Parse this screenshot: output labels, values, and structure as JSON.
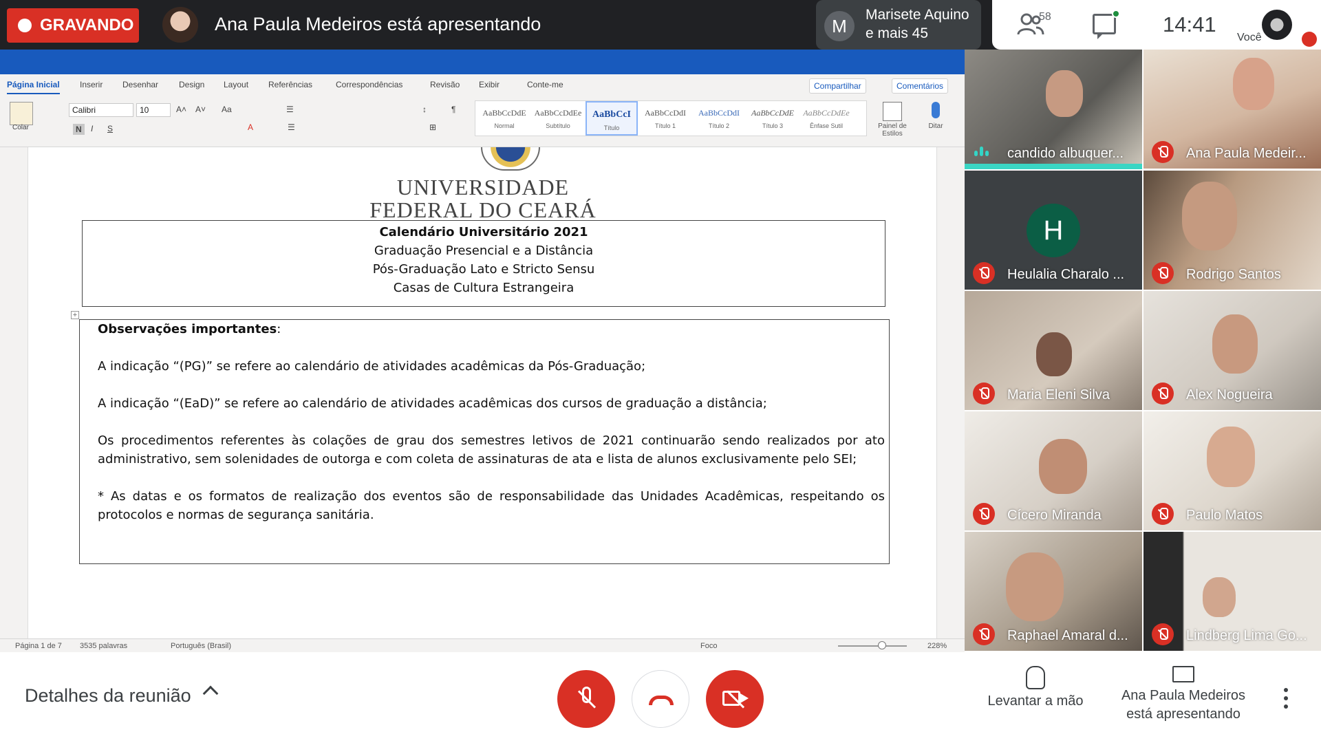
{
  "topbar": {
    "recording_label": "GRAVANDO",
    "presenter_text": "Ana Paula Medeiros está apresentando",
    "others_initial": "M",
    "others_line1": "Marisete Aquino",
    "others_line2": "e mais 45",
    "people_count": "58",
    "clock": "14:41",
    "you_label": "Você"
  },
  "word": {
    "tabs": [
      "Página Inicial",
      "Inserir",
      "Desenhar",
      "Design",
      "Layout",
      "Referências",
      "Correspondências",
      "Revisão",
      "Exibir",
      "Conte-me"
    ],
    "share_label": "Compartilhar",
    "comments_label": "Comentários",
    "paste_label": "Colar",
    "font_name": "Calibri",
    "font_size": "10",
    "styles": [
      {
        "sample": "AaBbCcDdE",
        "name": "Normal"
      },
      {
        "sample": "AaBbCcDdEe",
        "name": "Subtítulo"
      },
      {
        "sample": "AaBbCcI",
        "name": "Título"
      },
      {
        "sample": "AaBbCcDdI",
        "name": "Título 1"
      },
      {
        "sample": "AaBbCcDdI",
        "name": "Título 2"
      },
      {
        "sample": "AaBbCcDdE",
        "name": "Título 3"
      },
      {
        "sample": "AaBbCcDdEe",
        "name": "Ênfase Sutil"
      }
    ],
    "styles_pane_label": "Painel de Estilos",
    "dictate_label": "Ditar",
    "status": {
      "page": "Página 1 de 7",
      "words": "3535 palavras",
      "language": "Português (Brasil)",
      "focus": "Foco",
      "zoom": "228%"
    }
  },
  "document": {
    "uni_line1": "UNIVERSIDADE",
    "uni_line2": "FEDERAL DO CEARÁ",
    "box1": {
      "title": "Calendário Universitário 2021",
      "line2": "Graduação Presencial e a Distância",
      "line3": "Pós-Graduação Lato e Stricto Sensu",
      "line4": "Casas de Cultura Estrangeira"
    },
    "box2": {
      "heading": "Observações importantes",
      "heading_suffix": ":",
      "p1": "A indicação “(PG)” se refere ao calendário de atividades acadêmicas da Pós-Graduação;",
      "p2": "A indicação “(EaD)” se refere ao calendário de atividades acadêmicas dos cursos de graduação a distância;",
      "p3": "Os procedimentos referentes às colações de grau dos semestres letivos de 2021 continuarão sendo realizados por ato administrativo, sem solenidades de outorga e com coleta de assinaturas de ata e lista de alunos exclusivamente pelo SEI;",
      "p4": "* As datas e os formatos de realização dos eventos são de responsabilidade das Unidades Acadêmicas, respeitando os protocolos e normas de segurança sanitária."
    }
  },
  "participants": [
    {
      "name": "candido albuquer...",
      "state": "speaking"
    },
    {
      "name": "Ana Paula Medeir...",
      "state": "muted"
    },
    {
      "name": "Heulalia Charalo ...",
      "state": "muted",
      "initial": "H"
    },
    {
      "name": "Rodrigo Santos",
      "state": "muted"
    },
    {
      "name": "Maria Eleni Silva",
      "state": "muted"
    },
    {
      "name": "Alex Nogueira",
      "state": "muted"
    },
    {
      "name": "Cícero Miranda",
      "state": "muted"
    },
    {
      "name": "Paulo Matos",
      "state": "muted"
    },
    {
      "name": "Raphael Amaral d...",
      "state": "muted"
    },
    {
      "name": "Lindberg Lima Go...",
      "state": "muted"
    }
  ],
  "bottombar": {
    "details_label": "Detalhes da reunião",
    "raise_hand_label": "Levantar a mão",
    "presenting_line1": "Ana Paula Medeiros",
    "presenting_line2": "está apresentando"
  },
  "colors": {
    "record_red": "#d93025",
    "word_blue": "#185abd",
    "speaking_teal": "#3ad6c4",
    "meet_dark": "#202124"
  }
}
